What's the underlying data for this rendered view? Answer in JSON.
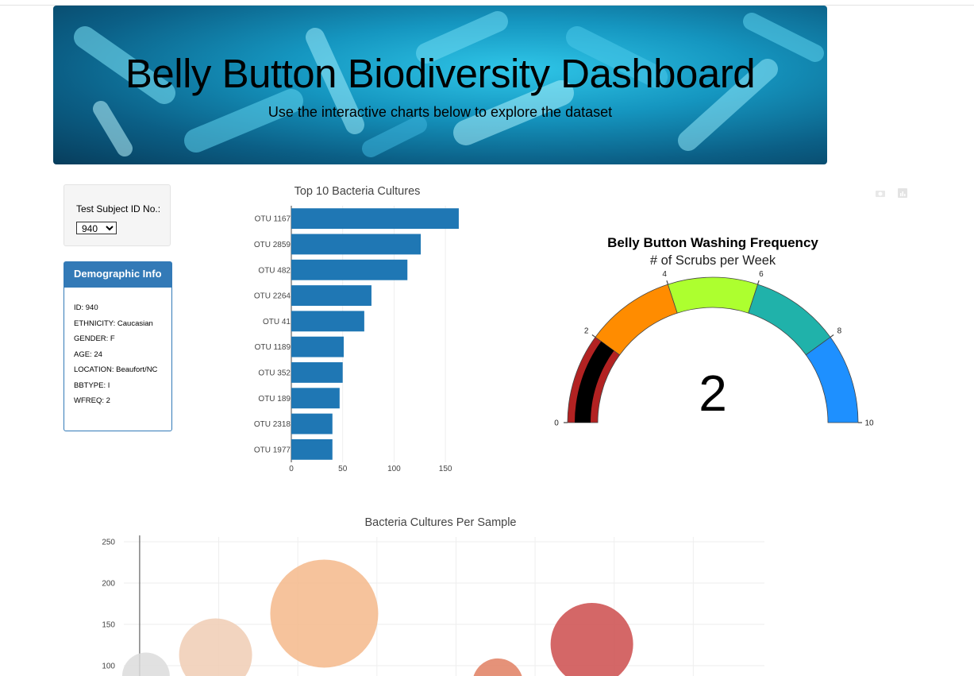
{
  "header": {
    "title": "Belly Button Biodiversity Dashboard",
    "subtitle": "Use the interactive charts below to explore the dataset"
  },
  "selector": {
    "label": "Test Subject ID No.:",
    "selected": "940"
  },
  "demographics": {
    "title": "Demographic Info",
    "items": [
      "ID: 940",
      "ETHNICITY: Caucasian",
      "GENDER: F",
      "AGE: 24",
      "LOCATION: Beaufort/NC",
      "BBTYPE: I",
      "WFREQ: 2"
    ]
  },
  "colors": {
    "bar": "#1f77b4",
    "panel": "#337ab7"
  },
  "chart_data": [
    {
      "type": "bar",
      "orientation": "horizontal",
      "title": "Top 10 Bacteria Cultures",
      "categories": [
        "OTU 1167",
        "OTU 2859",
        "OTU 482",
        "OTU 2264",
        "OTU 41",
        "OTU 1189",
        "OTU 352",
        "OTU 189",
        "OTU 2318",
        "OTU 1977"
      ],
      "values": [
        163,
        126,
        113,
        78,
        71,
        51,
        50,
        47,
        40,
        40
      ],
      "xticks": [
        0,
        50,
        100,
        150
      ],
      "xlim": [
        0,
        170
      ],
      "grid": true
    },
    {
      "type": "gauge",
      "title": "Belly Button Washing Frequency",
      "subtitle": "# of Scrubs per Week",
      "value": 2,
      "value_label": "2",
      "range": [
        0,
        10
      ],
      "ticks": [
        0,
        2,
        4,
        6,
        8,
        10
      ],
      "steps": [
        {
          "range": [
            0,
            2
          ],
          "color": "#b22222"
        },
        {
          "range": [
            2,
            4
          ],
          "color": "#ff8c00"
        },
        {
          "range": [
            4,
            6
          ],
          "color": "#adff2f"
        },
        {
          "range": [
            6,
            8
          ],
          "color": "#20b2aa"
        },
        {
          "range": [
            8,
            10
          ],
          "color": "#1e90ff"
        }
      ],
      "bar_color": "#000000"
    },
    {
      "type": "scatter",
      "style": "bubble",
      "title": "Bacteria Cultures Per Sample",
      "yticks": [
        100,
        150,
        200,
        250
      ],
      "ylim": [
        75,
        262
      ],
      "xlim": [
        -100,
        3950
      ],
      "grid": true,
      "points": [
        {
          "x": 40,
          "y": 87,
          "size": 30,
          "color": "#dcdcdc"
        },
        {
          "x": 480,
          "y": 113,
          "size": 46,
          "color": "#f0cdb4"
        },
        {
          "x": 1167,
          "y": 163,
          "size": 68,
          "color": "#f5b98b"
        },
        {
          "x": 2264,
          "y": 78,
          "size": 32,
          "color": "#e07f62"
        },
        {
          "x": 2859,
          "y": 126,
          "size": 52,
          "color": "#cc4c4c"
        }
      ]
    }
  ]
}
